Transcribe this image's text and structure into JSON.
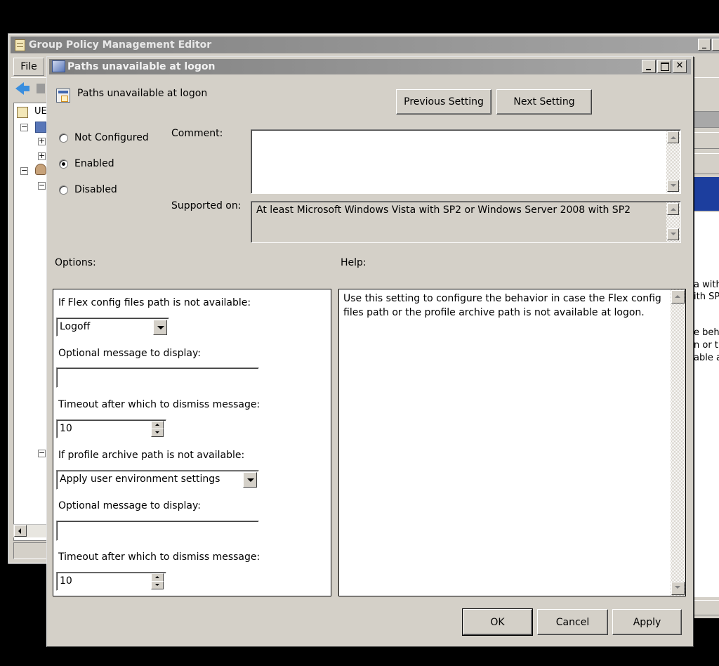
{
  "background_window": {
    "title": "Group Policy Management Editor",
    "menu_file": "File",
    "tree_root_label": "UE",
    "right_pane_lines": [
      "a with",
      "ith SP",
      "",
      "",
      "e beha",
      "n or th",
      "able a"
    ]
  },
  "dialog": {
    "title": "Paths unavailable at logon",
    "header_label": "Paths unavailable at logon",
    "previous_setting": "Previous Setting",
    "next_setting": "Next Setting",
    "state": {
      "options": [
        {
          "label": "Not Configured",
          "checked": false
        },
        {
          "label": "Enabled",
          "checked": true
        },
        {
          "label": "Disabled",
          "checked": false
        }
      ]
    },
    "comment_label": "Comment:",
    "comment_value": "",
    "supported_on_label": "Supported on:",
    "supported_on_value": "At least Microsoft Windows Vista with SP2 or Windows Server 2008 with SP2",
    "options_heading": "Options:",
    "help_heading": "Help:",
    "options_panel": {
      "flex_label": "If Flex config files path is not available:",
      "flex_selected": "Logoff",
      "msg1_label": "Optional message to display:",
      "msg1_value": "",
      "timeout1_label": "Timeout after which to dismiss message:",
      "timeout1_value": "10",
      "archive_label": "If profile archive path is not available:",
      "archive_selected": "Apply user environment settings",
      "msg2_label": "Optional message to display:",
      "msg2_value": "",
      "timeout2_label": "Timeout after which to dismiss message:",
      "timeout2_value": "10"
    },
    "help_lines": [
      "Use this setting to configure the behavior in case the Flex config",
      "files path or the profile archive path is not available at logon."
    ],
    "ok": "OK",
    "cancel": "Cancel",
    "apply": "Apply"
  }
}
